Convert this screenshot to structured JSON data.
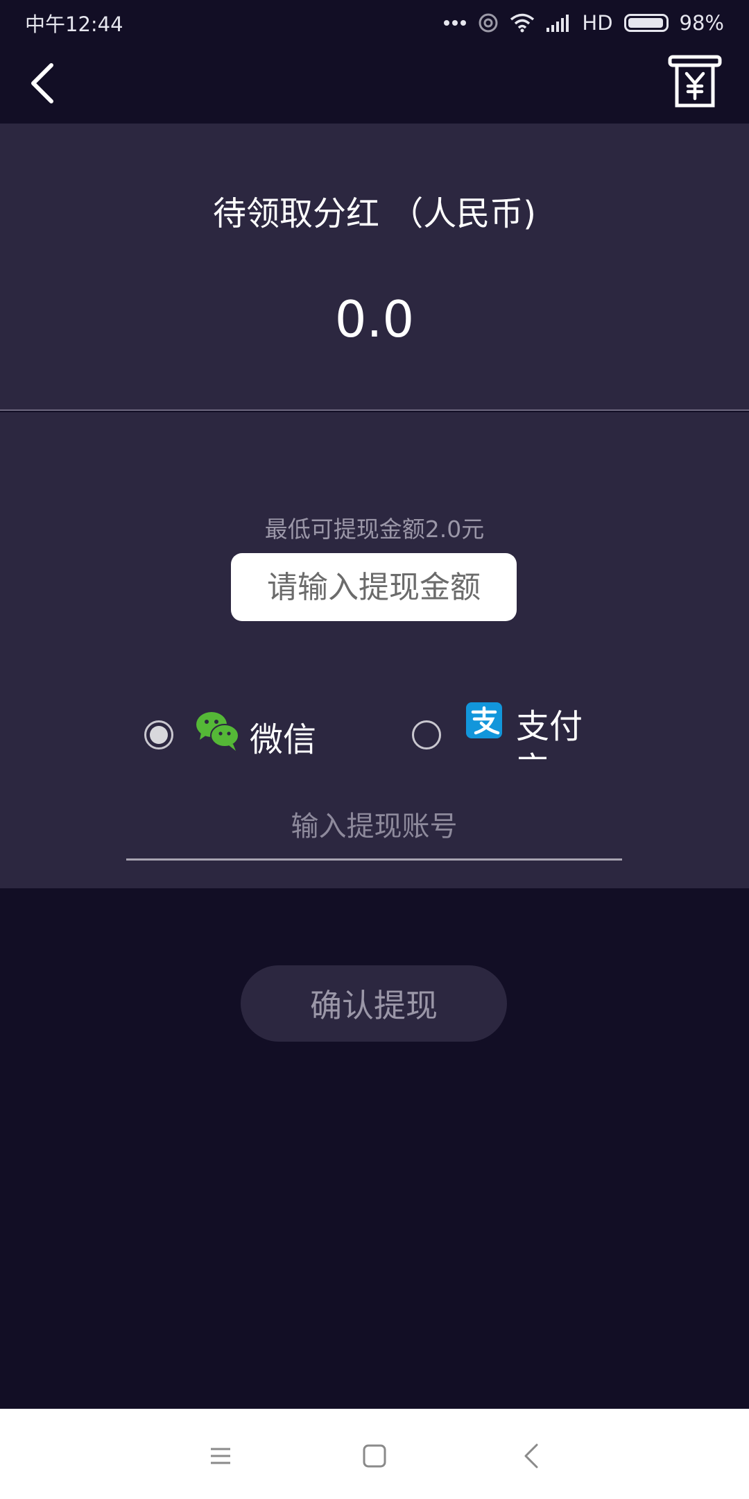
{
  "status_bar": {
    "time": "中午12:44",
    "network": "HD",
    "battery": "98%",
    "battery_level": 0.98
  },
  "header": {
    "back_icon": "chevron-left-icon",
    "receipt_icon": "yuan-receipt-icon"
  },
  "balance": {
    "title": "待领取分红 （人民币)",
    "amount": "0.0"
  },
  "withdraw": {
    "min_amount_text": "最低可提现金额2.0元",
    "amount_placeholder": "请输入提现金额",
    "payment_methods": [
      {
        "label": "微信",
        "icon": "wechat-icon",
        "selected": true
      },
      {
        "label": "支付宝",
        "icon": "alipay-icon",
        "selected": false
      }
    ],
    "account_placeholder": "输入提现账号",
    "confirm_label": "确认提现"
  },
  "colors": {
    "background": "#120e25",
    "panel": "#2c2740",
    "wechat_green": "#55b837",
    "alipay_blue": "#1296db"
  },
  "system_nav": {
    "menu_icon": "menu-icon",
    "home_icon": "home-square-icon",
    "back_icon": "back-triangle-icon"
  }
}
